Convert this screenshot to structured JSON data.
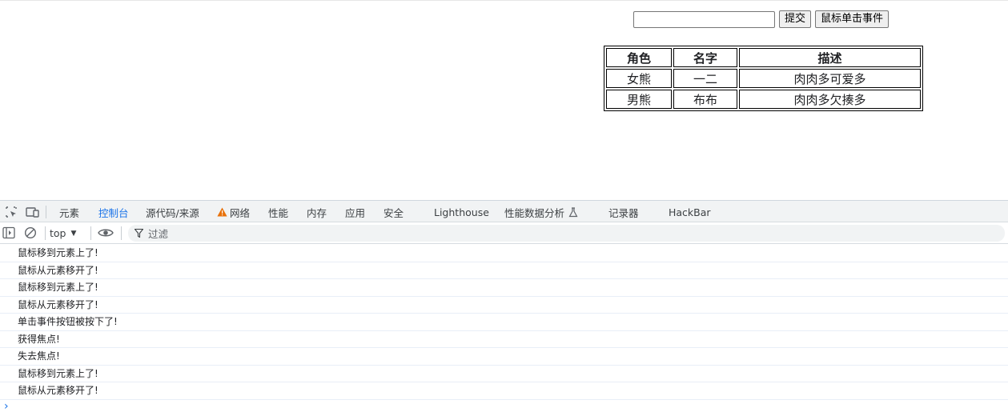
{
  "form": {
    "text_value": "",
    "submit_label": "提交",
    "click_event_label": "鼠标单击事件"
  },
  "table": {
    "headers": [
      "角色",
      "名字",
      "描述"
    ],
    "rows": [
      [
        "女熊",
        "一二",
        "肉肉多可爱多"
      ],
      [
        "男熊",
        "布布",
        "肉肉多欠揍多"
      ]
    ]
  },
  "devtools": {
    "tabs": [
      "元素",
      "控制台",
      "源代码/来源",
      "网络",
      "性能",
      "内存",
      "应用",
      "安全",
      "Lighthouse",
      "性能数据分析",
      "记录器",
      "HackBar"
    ],
    "active_tab": "控制台",
    "context": "top",
    "filter_placeholder": "过滤",
    "warning_color": "#e8710a",
    "accent_color": "#1a73e8",
    "icons": [
      "inspect-element-icon",
      "device-toolbar-icon",
      "warning-icon",
      "flask-icon",
      "sidebar-toggle-icon",
      "clear-console-icon",
      "eye-icon",
      "filter-icon",
      "prompt-chevron-icon"
    ]
  },
  "console": {
    "messages": [
      "鼠标移到元素上了!",
      "鼠标从元素移开了!",
      "鼠标移到元素上了!",
      "鼠标从元素移开了!",
      "单击事件按钮被按下了!",
      "获得焦点!",
      "失去焦点!",
      "鼠标移到元素上了!",
      "鼠标从元素移开了!"
    ],
    "prompt": "›"
  }
}
